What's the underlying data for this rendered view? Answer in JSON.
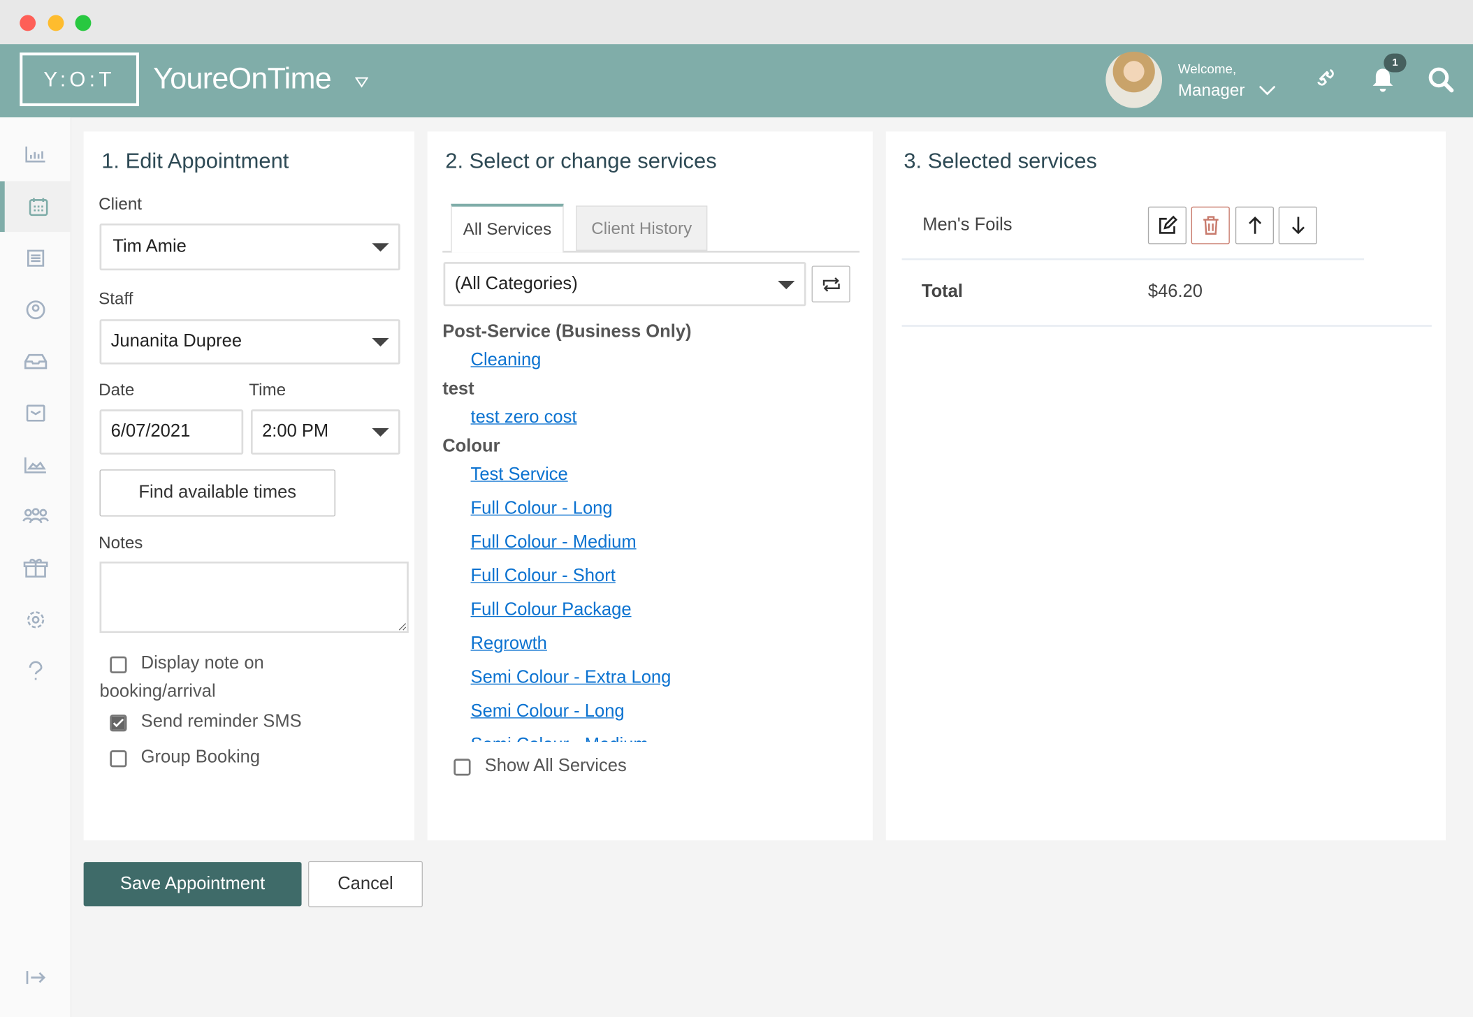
{
  "header": {
    "logo": "Y:O:T",
    "brand": "YoureOnTime",
    "welcome": "Welcome,",
    "user": "Manager",
    "notification_count": "1",
    "color": "#80ada9"
  },
  "sidebar": {
    "items": [
      "dashboard",
      "calendar",
      "receipts",
      "clients",
      "inbox",
      "messages",
      "reports",
      "staff",
      "products",
      "settings",
      "help"
    ],
    "active": "calendar",
    "logout": "logout"
  },
  "edit": {
    "title": "1. Edit Appointment",
    "client_label": "Client",
    "client": "Tim Amie",
    "staff_label": "Staff",
    "staff": "Junanita Dupree",
    "date_label": "Date",
    "date": "6/07/2021",
    "time_label": "Time",
    "time": "2:00 PM",
    "find_times": "Find available times",
    "notes_label": "Notes",
    "notes": "",
    "display_note_1": "Display note on",
    "display_note_2": "booking/arrival",
    "send_sms": "Send reminder SMS",
    "group_booking": "Group Booking",
    "display_note_checked": false,
    "send_sms_checked": true,
    "group_booking_checked": false
  },
  "services": {
    "title": "2. Select or change services",
    "tabs": [
      "All Services",
      "Client History"
    ],
    "category": "(All Categories)",
    "groups": [
      {
        "name": "Post-Service (Business Only)",
        "items": [
          "Cleaning"
        ]
      },
      {
        "name": "test",
        "items": [
          "test zero cost"
        ]
      },
      {
        "name": "Colour",
        "items": [
          "Test Service",
          "Full Colour - Long",
          "Full Colour - Medium",
          "Full Colour - Short",
          "Full Colour Package",
          "Regrowth",
          "Semi Colour - Extra Long",
          "Semi Colour - Long",
          "Semi Colour - Medium"
        ]
      }
    ],
    "show_all": "Show All Services",
    "show_all_checked": false
  },
  "selected": {
    "title": "3. Selected services",
    "items": [
      {
        "name": "Men's Foils"
      }
    ],
    "total_label": "Total",
    "total": "$46.20"
  },
  "actions": {
    "save": "Save Appointment",
    "cancel": "Cancel",
    "save_color": "#3f6b69"
  }
}
